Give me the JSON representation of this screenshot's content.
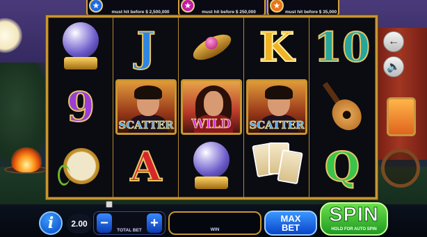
{
  "jackpots": [
    {
      "icon": "star-icon",
      "color": "#1a6ae8",
      "text": "must hit before $ 2,500,000"
    },
    {
      "icon": "star-icon",
      "color": "#c21aa8",
      "text": "must hit before $ 250,000"
    },
    {
      "icon": "star-icon",
      "color": "#e8731a",
      "text": "must hit before $ 35,000"
    }
  ],
  "reels": [
    [
      {
        "symbol": "crystal-ball"
      },
      {
        "symbol": "9"
      },
      {
        "symbol": "tambourine"
      }
    ],
    [
      {
        "symbol": "J"
      },
      {
        "symbol": "scatter",
        "label": "SCATTER"
      },
      {
        "symbol": "A"
      }
    ],
    [
      {
        "symbol": "mask"
      },
      {
        "symbol": "wild",
        "label": "WILD"
      },
      {
        "symbol": "crystal-ball"
      }
    ],
    [
      {
        "symbol": "K"
      },
      {
        "symbol": "scatter",
        "label": "SCATTER"
      },
      {
        "symbol": "tarot-cards"
      }
    ],
    [
      {
        "symbol": "10"
      },
      {
        "symbol": "guitar"
      },
      {
        "symbol": "Q"
      }
    ]
  ],
  "side_buttons": {
    "back_icon": "arrow-left-icon",
    "sound_icon": "speaker-icon"
  },
  "controls": {
    "info_label": "i",
    "bet_value": "2.00",
    "minus_label": "−",
    "plus_label": "+",
    "total_bet_label": "TOTAL BET",
    "win_value": "",
    "win_label": "WIN",
    "max_bet_label": "MAX BET",
    "spin_label": "SPIN",
    "spin_sub_label": "HOLD FOR AUTO SPIN"
  }
}
